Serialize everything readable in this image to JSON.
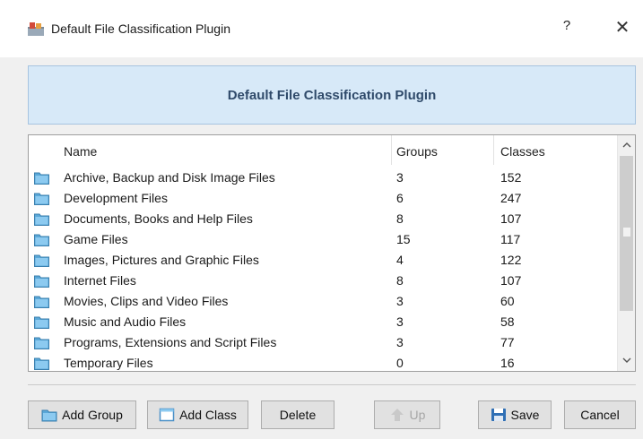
{
  "window": {
    "title": "Default File Classification Plugin",
    "help_glyph": "?",
    "close_glyph": "✕"
  },
  "banner": {
    "text": "Default File Classification Plugin"
  },
  "list": {
    "columns": [
      "Name",
      "Groups",
      "Classes"
    ],
    "rows": [
      {
        "name": "Archive, Backup and Disk Image Files",
        "groups": "3",
        "classes": "152"
      },
      {
        "name": "Development Files",
        "groups": "6",
        "classes": "247"
      },
      {
        "name": "Documents, Books and Help Files",
        "groups": "8",
        "classes": "107"
      },
      {
        "name": "Game Files",
        "groups": "15",
        "classes": "117"
      },
      {
        "name": "Images, Pictures and Graphic Files",
        "groups": "4",
        "classes": "122"
      },
      {
        "name": "Internet Files",
        "groups": "8",
        "classes": "107"
      },
      {
        "name": "Movies, Clips and Video Files",
        "groups": "3",
        "classes": "60"
      },
      {
        "name": "Music and Audio Files",
        "groups": "3",
        "classes": "58"
      },
      {
        "name": "Programs, Extensions and Script Files",
        "groups": "3",
        "classes": "77"
      },
      {
        "name": "Temporary Files",
        "groups": "0",
        "classes": "16"
      }
    ],
    "row_icon": "folder-icon",
    "scroll_up_glyph": "^",
    "scroll_down_glyph": "v"
  },
  "buttons": {
    "add_group": "Add Group",
    "add_class": "Add Class",
    "delete": "Delete",
    "up": "Up",
    "save": "Save",
    "cancel": "Cancel"
  },
  "colors": {
    "banner_bg": "#d7e9f8",
    "banner_text": "#2f4a6a",
    "folder": "#5aa8d8"
  }
}
